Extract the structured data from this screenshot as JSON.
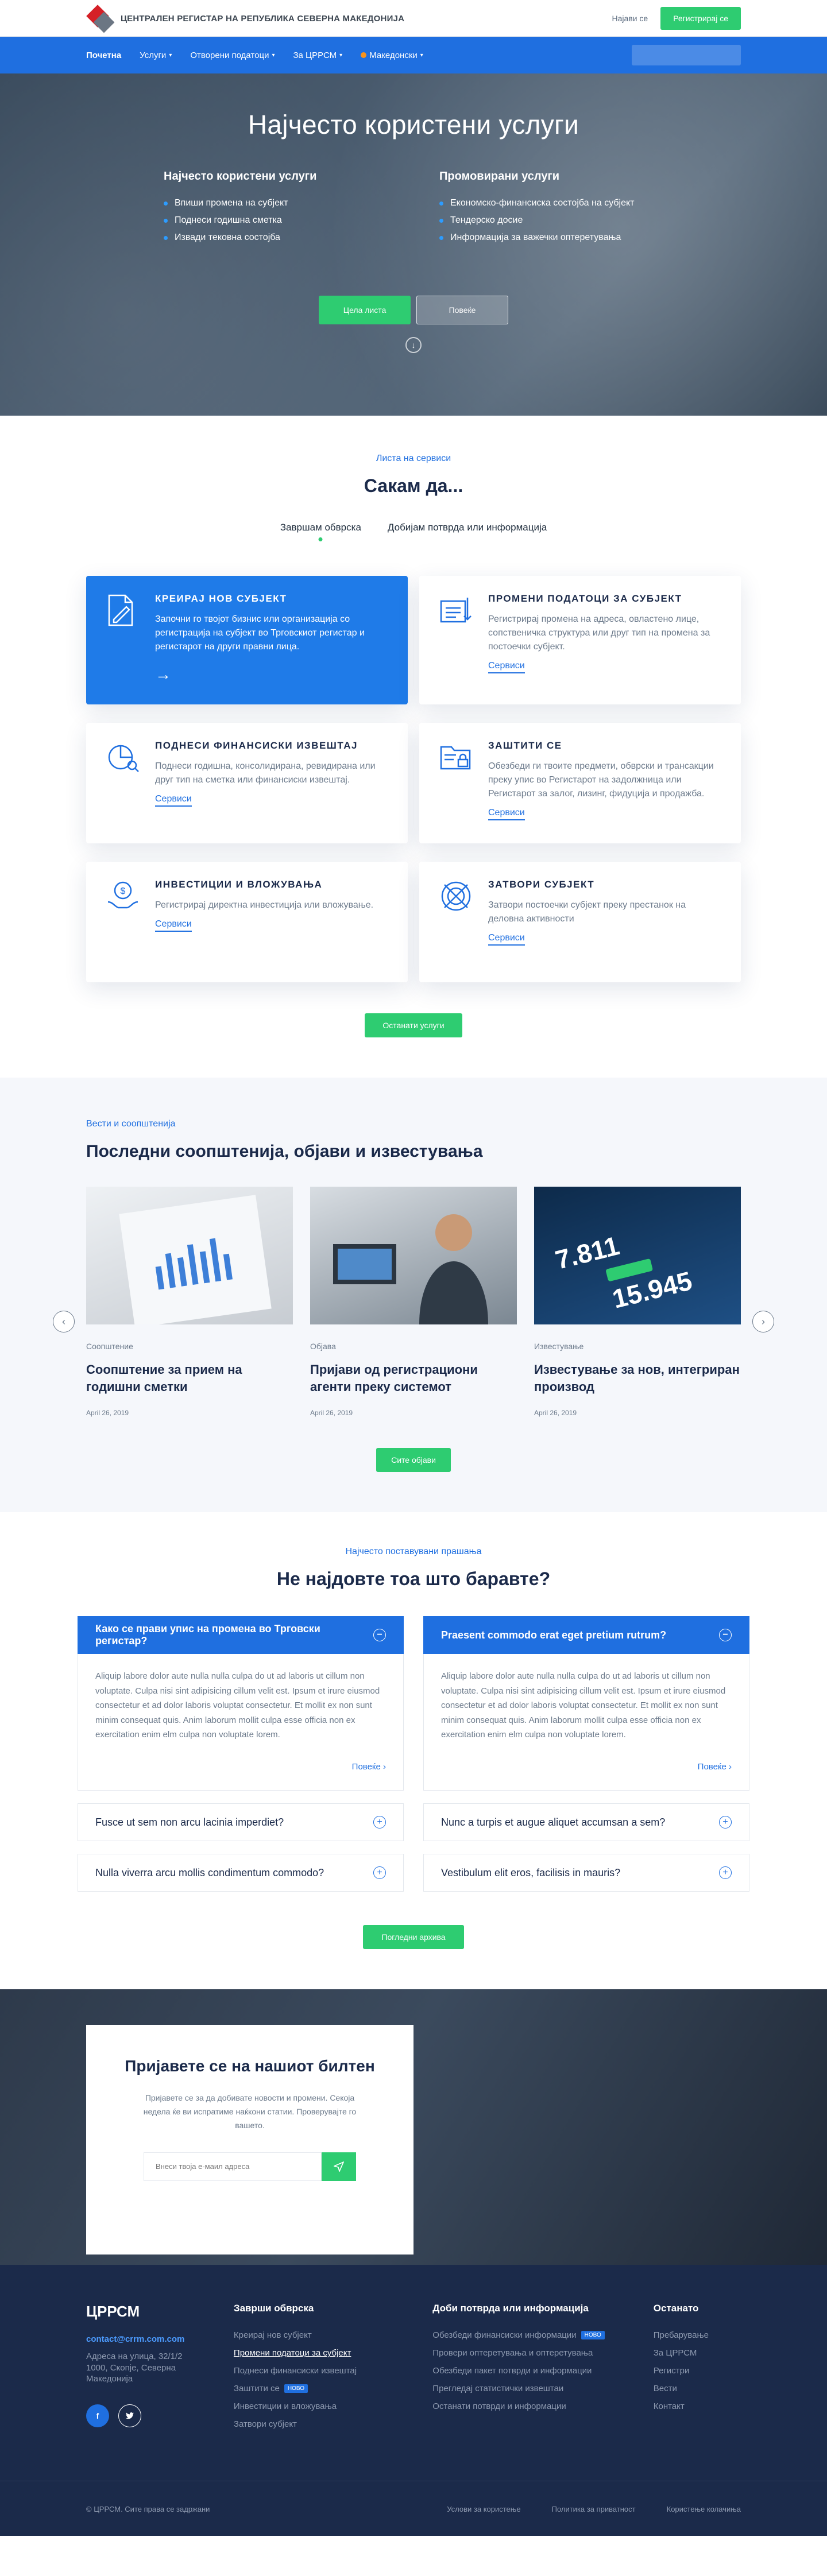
{
  "header": {
    "brand": "ЦЕНТРАЛЕН РЕГИСТАР НА РЕПУБЛИКА СЕВЕРНА МАКЕДОНИЈА",
    "login": "Најави се",
    "register": "Регистрирај се"
  },
  "nav": {
    "items": [
      "Почетна",
      "Услуги",
      "Отворени податоци",
      "За ЦРРСМ",
      "Македонски"
    ],
    "search_placeholder": ""
  },
  "hero": {
    "title": "Најчесто користени услуги",
    "left_title": "Најчесто користени услуги",
    "left_items": [
      "Впиши промена на субјект",
      "Поднеси годишна сметка",
      "Извади тековна состојба"
    ],
    "right_title": "Промовирани услуги",
    "right_items": [
      "Економско-финансиска состојба на субјект",
      "Тендерско досие",
      "Информација за важечки оптеретувања"
    ],
    "btn_primary": "Цела листа",
    "btn_secondary": "Повеќе"
  },
  "services": {
    "eyebrow": "Листа на сервиси",
    "title": "Сакам да...",
    "tabs": [
      "Завршам обврска",
      "Добијам потврда или информација"
    ],
    "cards": [
      {
        "title": "КРЕИРАЈ НОВ СУБЈЕКТ",
        "text": "Започни го твојот бизнис или организација со регистрација на субјект во Трговскиот регистар и регистарот на други правни лица.",
        "link": ""
      },
      {
        "title": "ПРОМЕНИ ПОДАТОЦИ ЗА СУБЈЕКТ",
        "text": "Регистрирај промена на адреса, овластено лице, сопственичка структура или друг тип на промена за постоечки субјект.",
        "link": "Сервиси"
      },
      {
        "title": "ПОДНЕСИ ФИНАНСИСКИ ИЗВЕШТАЈ",
        "text": "Поднеси годишна, консолидирана, ревидирана или друг тип на сметка или финансиски извештај.",
        "link": "Сервиси"
      },
      {
        "title": "ЗАШТИТИ СЕ",
        "text": "Обезбеди ги твоите предмети, обврски и трансакции преку упис во Регистарот на задолжница или Регистарот за залог, лизинг, фидуција и продажба.",
        "link": "Сервиси"
      },
      {
        "title": "ИНВЕСТИЦИИ И ВЛОЖУВАЊА",
        "text": "Регистрирај директна инвестиција или вложување.",
        "link": "Сервиси"
      },
      {
        "title": "ЗАТВОРИ СУБЈЕКТ",
        "text": "Затвори постоечки субјект преку престанок на деловна активности",
        "link": "Сервиси"
      }
    ],
    "other_btn": "Останати услуги"
  },
  "news": {
    "eyebrow": "Вести и соопштенија",
    "title": "Последни соопштенија, објави и известувања",
    "items": [
      {
        "category": "Соопштение",
        "title": "Соопштение за  прием на годишни сметки",
        "date": "April 26, 2019"
      },
      {
        "category": "Објава",
        "title": "Пријави од регистрациони агенти преку системот",
        "date": "April 26, 2019"
      },
      {
        "category": "Известување",
        "title": "Известување за нов, интегриран производ",
        "date": "April 26, 2019"
      }
    ],
    "all_btn": "Сите објави"
  },
  "faq": {
    "eyebrow": "Најчесто поставувани прашања",
    "title": "Не најдовте тоа што баравте?",
    "left": [
      {
        "q": "Како се прави упис на промена во Трговски регистар?",
        "a": "Aliquip labore dolor aute nulla nulla culpa do ut ad laboris ut cillum non voluptate. Culpa nisi sint adipisicing cillum velit est. Ipsum et irure eiusmod consectetur et ad dolor laboris voluptat consectetur. Et mollit ex non sunt minim consequat quis. Anim laborum mollit culpa esse officia non ex exercitation enim elm  culpa non voluptate lorem.",
        "more": "Повеќе"
      },
      {
        "q": "Fusce ut sem non arcu lacinia imperdiet?"
      },
      {
        "q": "Nulla viverra arcu mollis condimentum commodo?"
      }
    ],
    "right": [
      {
        "q": "Praesent commodo erat eget pretium rutrum?",
        "a": "Aliquip labore dolor aute nulla nulla culpa do ut ad laboris ut cillum non voluptate. Culpa nisi sint adipisicing cillum velit est. Ipsum et irure eiusmod consectetur et ad dolor laboris voluptat consectetur. Et mollit ex non sunt minim consequat quis. Anim laborum mollit culpa esse officia non ex exercitation enim elm  culpa non voluptate lorem.",
        "more": "Повеќе"
      },
      {
        "q": "Nunc a turpis et augue aliquet accumsan a sem?"
      },
      {
        "q": "Vestibulum elit eros, facilisis in mauris?"
      }
    ],
    "archive_btn": "Погледни архива"
  },
  "newsletter": {
    "title": "Пријавете се на нашиот билтен",
    "text": "Пријавете се за да добивате новости и промени. Секоја недела ќе ви испратиме наќкони статии. Проверувајте го вашето.",
    "placeholder": "Внеси твоја е-маил адреса"
  },
  "footer": {
    "logo": "ЦРРСМ",
    "email": "contact@crrm.com.com",
    "address": "Адреса на улица, 32/1/2 1000, Скопје, Северна Македонија",
    "col2_title": "Заврши обврска",
    "col2_items": [
      "Креирај нов субјект",
      "Промени податоци за субјект",
      "Поднеси финансиски извештај",
      "Заштити се",
      "Инвестиции и вложувања",
      "Затвори субјект"
    ],
    "col3_title": "Доби потврда или информација",
    "col3_items": [
      "Обезбеди финансиски информации",
      "Провери оптеретувања и оптеретувања",
      "Обезбеди пакет потврди и информации",
      "Прегледај статистички извештаи",
      "Останати потврди и информации"
    ],
    "col4_title": "Останато",
    "col4_items": [
      "Пребарување",
      "За ЦРРСМ",
      "Регистри",
      "Вести",
      "Контакт"
    ],
    "new_badge": "НОВО",
    "copyright": "© ЦРРСМ. Сите права се задржани",
    "bottom_links": [
      "Услови за користење",
      "Политика за приватност",
      "Користење колачиња"
    ]
  },
  "colors": {
    "primary": "#1f6fe0",
    "accent": "#2ecc71",
    "navy": "#1b2a4a"
  }
}
